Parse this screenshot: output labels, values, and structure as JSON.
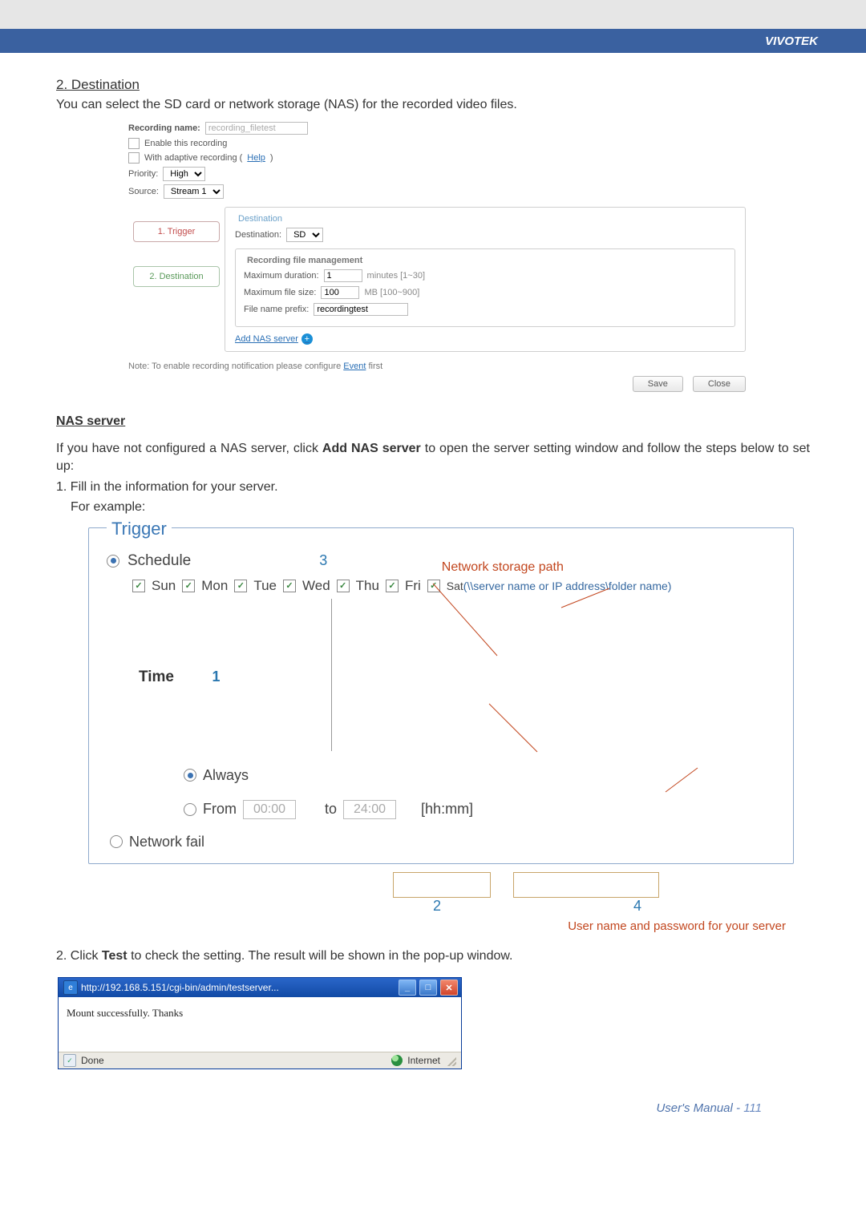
{
  "brand": "VIVOTEK",
  "sec_title": "2. Destination",
  "sec_intro": "You can select the SD card or network storage (NAS) for the recorded video files.",
  "ss1": {
    "rec_name_label": "Recording name:",
    "rec_name_value": "recording_filetest",
    "enable_label": "Enable this recording",
    "adaptive_label": "With adaptive recording (",
    "help": "Help",
    "adaptive_close": ")",
    "priority_label": "Priority:",
    "priority_value": "High",
    "source_label": "Source:",
    "source_value": "Stream 1",
    "dest_legend": "Destination",
    "dest_label": "Destination:",
    "dest_value": "SD",
    "sub_legend": "Recording file management",
    "max_dur_label": "Maximum duration:",
    "max_dur_val": "1",
    "max_dur_suffix": "minutes [1~30]",
    "max_size_label": "Maximum file size:",
    "max_size_val": "100",
    "max_size_suffix": "MB [100~900]",
    "prefix_label": "File name prefix:",
    "prefix_val": "recordingtest",
    "add_nas": "Add NAS server",
    "step1": "1. Trigger",
    "step2": "2. Destination",
    "note_pre": "Note: To enable recording notification please configure ",
    "note_link": "Event",
    "note_post": " first",
    "save": "Save",
    "close": "Close"
  },
  "nas_head": "NAS server",
  "nas_para": "If you have not configured a NAS server, click Add NAS server to open the server setting window and follow the steps below to set up:",
  "nas_step1": "1. Fill in the information for your server.",
  "nas_step1b": "For example:",
  "ss2": {
    "legend": "Trigger",
    "schedule": "Schedule",
    "marker3": "3",
    "days": [
      "Sun",
      "Mon",
      "Tue",
      "Wed",
      "Thu",
      "Fri"
    ],
    "sat_merged": "Sat",
    "path_top": "Network storage path",
    "path_hint": "(\\\\server name or IP address\\folder name)",
    "time": "Time",
    "marker1": "1",
    "always": "Always",
    "from": "From",
    "from_val": "00:00",
    "to": "to",
    "to_val": "24:00",
    "hhmm": "[hh:mm]",
    "netfail": "Network fail",
    "marker2": "2",
    "marker4": "4",
    "userpw": "User name and password for your server"
  },
  "nas_step2": "2. Click Test to check the setting. The result will be shown in the pop-up window.",
  "popup": {
    "title": "http://192.168.5.151/cgi-bin/admin/testserver...",
    "body": "Mount successfully. Thanks",
    "done": "Done",
    "zone": "Internet"
  },
  "footer_left": "User's Manual - ",
  "footer_page": "111"
}
